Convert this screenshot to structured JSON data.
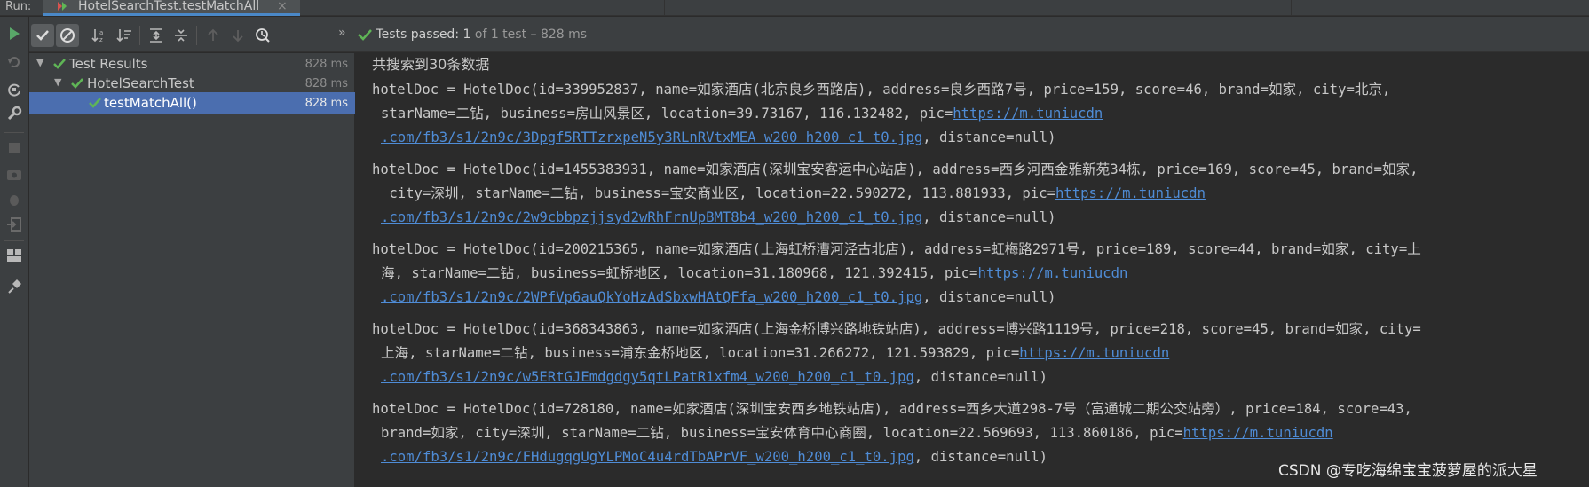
{
  "run_bar": {
    "label": "Run:",
    "tab_title": "HotelSearchTest.testMatchAll",
    "tab_close": "×"
  },
  "toolbar": {
    "chevron": "»",
    "status_prefix": "Tests passed: ",
    "status_count": "1",
    "status_suffix": " of 1 test – 828 ms",
    "icons": [
      "rerun-icon",
      "show-passed-icon",
      "show-ignored-icon",
      "sort-alpha-icon",
      "sort-duration-icon",
      "expand-all-icon",
      "collapse-all-icon",
      "prev-failed-icon",
      "next-failed-icon",
      "history-icon"
    ]
  },
  "tree": {
    "items": [
      {
        "label": "Test Results",
        "duration": "828 ms"
      },
      {
        "label": "HotelSearchTest",
        "duration": "828 ms"
      },
      {
        "label": "testMatchAll()",
        "duration": "828 ms"
      }
    ]
  },
  "console": {
    "header": "共搜索到30条数据",
    "records": [
      {
        "l1": "hotelDoc = HotelDoc(id=339952837, name=如家酒店(北京良乡西路店), address=良乡西路7号, price=159, score=46, brand=如家, city=北京,",
        "l2a": "starName=二钻, business=房山风景区, location=39.73167, 116.132482, pic=",
        "l2link": "https://m.tuniucdn",
        "l3link": ".com/fb3/s1/2n9c/3Dpgf5RTTzrxpeN5y3RLnRVtxMEA_w200_h200_c1_t0.jpg",
        "l3b": ", distance=null)"
      },
      {
        "l1": "hotelDoc = HotelDoc(id=1455383931, name=如家酒店(深圳宝安客运中心站店), address=西乡河西金雅新苑34栋, price=169, score=45, brand=如家,",
        "l2a": " city=深圳, starName=二钻, business=宝安商业区, location=22.590272, 113.881933, pic=",
        "l2link": "https://m.tuniucdn",
        "l3link": ".com/fb3/s1/2n9c/2w9cbbpzjjsyd2wRhFrnUpBMT8b4_w200_h200_c1_t0.jpg",
        "l3b": ", distance=null)"
      },
      {
        "l1": "hotelDoc = HotelDoc(id=200215365, name=如家酒店(上海虹桥漕河泾古北店), address=虹梅路2971号, price=189, score=44, brand=如家, city=上",
        "l2a": "海, starName=二钻, business=虹桥地区, location=31.180968, 121.392415, pic=",
        "l2link": "https://m.tuniucdn",
        "l3link": ".com/fb3/s1/2n9c/2WPfVp6auQkYoHzAdSbxwHAtQFfa_w200_h200_c1_t0.jpg",
        "l3b": ", distance=null)"
      },
      {
        "l1": "hotelDoc = HotelDoc(id=368343863, name=如家酒店(上海金桥博兴路地铁站店), address=博兴路1119号, price=218, score=45, brand=如家, city=",
        "l2a": "上海, starName=二钻, business=浦东金桥地区, location=31.266272, 121.593829, pic=",
        "l2link": "https://m.tuniucdn",
        "l3link": ".com/fb3/s1/2n9c/w5ERtGJEmdgdgy5qtLPatR1xfm4_w200_h200_c1_t0.jpg",
        "l3b": ", distance=null)"
      },
      {
        "l1": "hotelDoc = HotelDoc(id=728180, name=如家酒店(深圳宝安西乡地铁站店), address=西乡大道298-7号（富通城二期公交站旁）, price=184, score=43,",
        "l2a": "brand=如家, city=深圳, starName=二钻, business=宝安体育中心商圈, location=22.569693, 113.860186, pic=",
        "l2link": "https://m.tuniucdn",
        "l3link": ".com/fb3/s1/2n9c/FHdugqgUgYLPMoC4u4rdTbAPrVF_w200_h200_c1_t0.jpg",
        "l3b": ", distance=null)"
      }
    ]
  },
  "watermark": "CSDN @专吃海绵宝宝菠萝屋的派大星",
  "colors": {
    "pass_green": "#5fb556",
    "link_blue": "#4f8cd6",
    "selection": "#4b6eaf",
    "rerun_green": "#59a869"
  }
}
